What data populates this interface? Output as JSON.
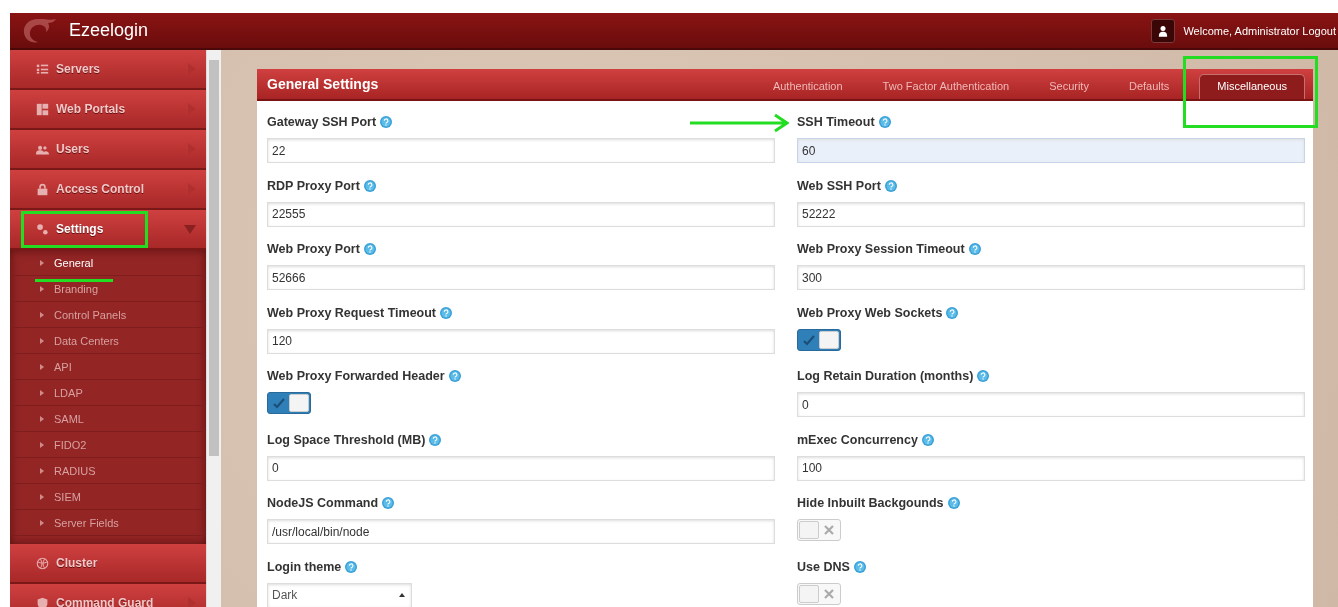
{
  "header": {
    "brand": "Ezeelogin",
    "welcome": "Welcome, Administrator",
    "logout": "Logout"
  },
  "sidebar": {
    "items": [
      {
        "label": "Servers",
        "submenu": true,
        "expanded": false
      },
      {
        "label": "Web Portals",
        "submenu": true,
        "expanded": false
      },
      {
        "label": "Users",
        "submenu": true,
        "expanded": false
      },
      {
        "label": "Access Control",
        "submenu": true,
        "expanded": false
      },
      {
        "label": "Settings",
        "submenu": true,
        "expanded": true,
        "children": [
          {
            "label": "General",
            "selected": true
          },
          {
            "label": "Branding",
            "selected": false
          },
          {
            "label": "Control Panels",
            "selected": false
          },
          {
            "label": "Data Centers",
            "selected": false
          },
          {
            "label": "API",
            "selected": false
          },
          {
            "label": "LDAP",
            "selected": false
          },
          {
            "label": "SAML",
            "selected": false
          },
          {
            "label": "FIDO2",
            "selected": false
          },
          {
            "label": "RADIUS",
            "selected": false
          },
          {
            "label": "SIEM",
            "selected": false
          },
          {
            "label": "Server Fields",
            "selected": false
          }
        ]
      },
      {
        "label": "Cluster",
        "submenu": false,
        "expanded": false
      },
      {
        "label": "Command Guard",
        "submenu": true,
        "expanded": false
      }
    ]
  },
  "panel": {
    "title": "General Settings",
    "tabs": [
      {
        "label": "Authentication",
        "selected": false
      },
      {
        "label": "Two Factor Authentication",
        "selected": false
      },
      {
        "label": "Security",
        "selected": false
      },
      {
        "label": "Defaults",
        "selected": false
      },
      {
        "label": "Miscellaneous",
        "selected": true
      }
    ],
    "fields": [
      {
        "kind": "text",
        "label": "Gateway SSH Port",
        "value": "22",
        "focused": false
      },
      {
        "kind": "text",
        "label": "SSH Timeout",
        "value": "60",
        "focused": true
      },
      {
        "kind": "text",
        "label": "RDP Proxy Port",
        "value": "22555",
        "focused": false
      },
      {
        "kind": "text",
        "label": "Web SSH Port",
        "value": "52222",
        "focused": false
      },
      {
        "kind": "text",
        "label": "Web Proxy Port",
        "value": "52666",
        "focused": false
      },
      {
        "kind": "text",
        "label": "Web Proxy Session Timeout",
        "value": "300",
        "focused": false
      },
      {
        "kind": "text",
        "label": "Web Proxy Request Timeout",
        "value": "120",
        "focused": false
      },
      {
        "kind": "toggle",
        "label": "Web Proxy Web Sockets",
        "on": true
      },
      {
        "kind": "toggle",
        "label": "Web Proxy Forwarded Header",
        "on": true
      },
      {
        "kind": "text",
        "label": "Log Retain Duration (months)",
        "value": "0",
        "focused": false
      },
      {
        "kind": "text",
        "label": "Log Space Threshold (MB)",
        "value": "0",
        "focused": false
      },
      {
        "kind": "text",
        "label": "mExec Concurrency",
        "value": "100",
        "focused": false
      },
      {
        "kind": "text",
        "label": "NodeJS Command",
        "value": "/usr/local/bin/node",
        "focused": false
      },
      {
        "kind": "toggle",
        "label": "Hide Inbuilt Backgounds",
        "on": false
      },
      {
        "kind": "select",
        "label": "Login theme",
        "value": "Dark"
      },
      {
        "kind": "toggle",
        "label": "Use DNS",
        "on": false
      }
    ]
  }
}
